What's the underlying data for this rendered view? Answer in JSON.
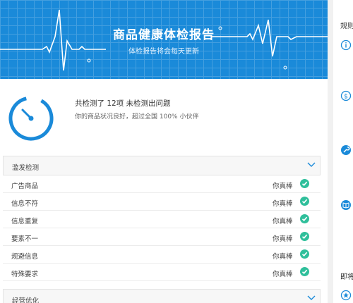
{
  "banner": {
    "title": "商品健康体检报告",
    "subtitle": "体检报告将会每天更新"
  },
  "summary": {
    "line1": "共检测了 12项 未检测出问题",
    "line2": "你的商品状况良好，超过全国 100% 小伙伴"
  },
  "sections": [
    {
      "label": "滥发检测",
      "rows": [
        {
          "name": "广告商品",
          "status": "你真棒"
        },
        {
          "name": "信息不符",
          "status": "你真棒"
        },
        {
          "name": "信息重复",
          "status": "你真棒"
        },
        {
          "name": "要素不一",
          "status": "你真棒"
        },
        {
          "name": "规避信息",
          "status": "你真棒"
        },
        {
          "name": "特殊要求",
          "status": "你真棒"
        }
      ]
    },
    {
      "label": "经营优化"
    }
  ],
  "sidebar": {
    "top_label": "规则",
    "bottom_label": "即将",
    "icons": [
      "info-icon",
      "dollar-icon",
      "wrench-icon",
      "book-icon",
      "star-icon"
    ]
  },
  "colors": {
    "banner": "#1a8ad9",
    "accent": "#1a8ad9",
    "ok": "#2fbf9b"
  }
}
